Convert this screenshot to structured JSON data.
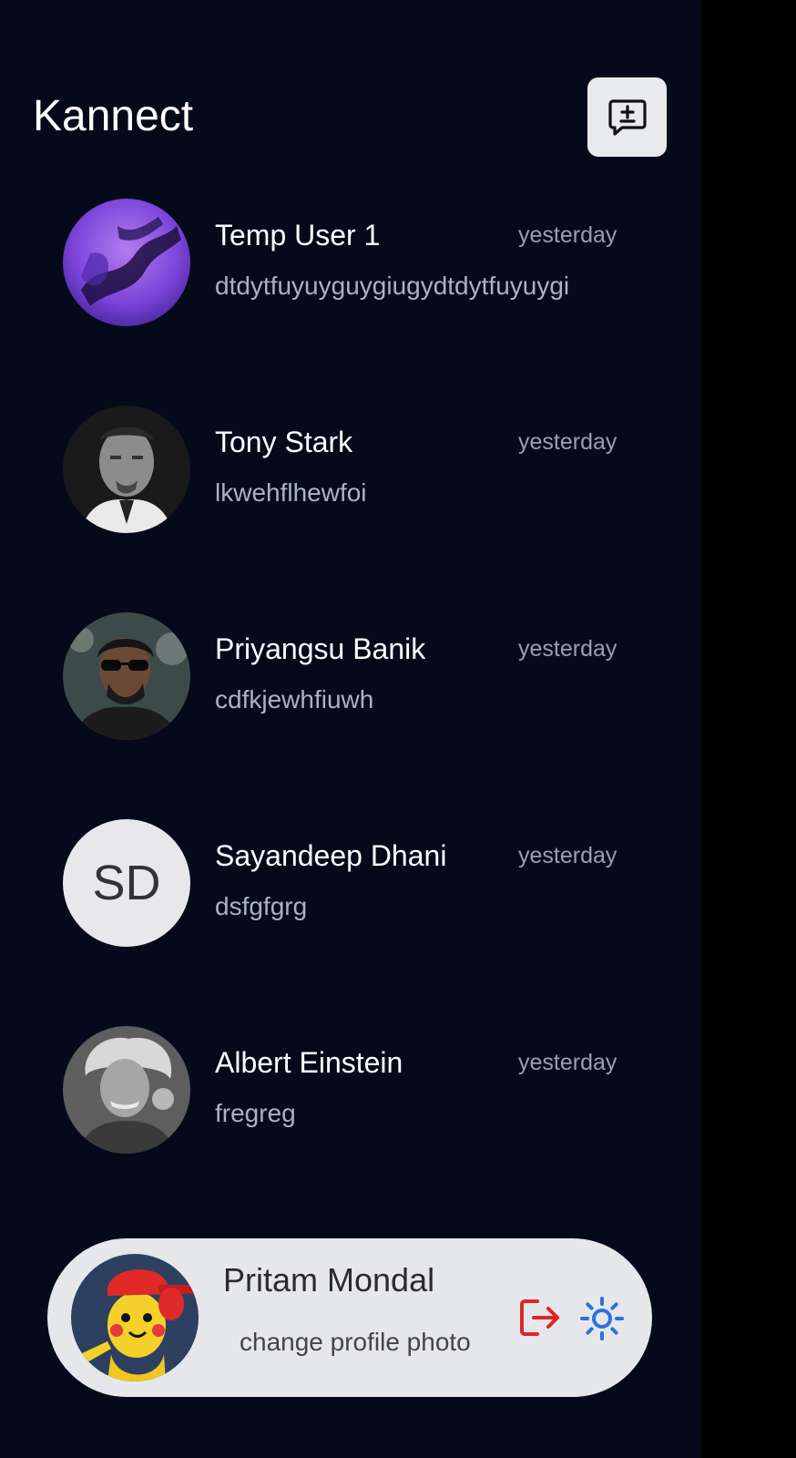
{
  "app": {
    "title": "Kannect"
  },
  "header": {
    "new_chat_icon": "new-chat-icon"
  },
  "chats": [
    {
      "name": "Temp User 1",
      "time": "yesterday",
      "preview": "dtdytfuyuyguygiugydtdytfuyuygi",
      "avatar": "abstract-purple-avatar"
    },
    {
      "name": "Tony Stark",
      "time": "yesterday",
      "preview": "lkwehflhewfoi",
      "avatar": "tony-stark-photo"
    },
    {
      "name": "Priyangsu Banik",
      "time": "yesterday",
      "preview": "cdfkjewhfiuwh",
      "avatar": "priyangsu-photo"
    },
    {
      "name": "Sayandeep Dhani",
      "time": "yesterday",
      "preview": "dsfgfgrg",
      "avatar_initials": "SD"
    },
    {
      "name": "Albert Einstein",
      "time": "yesterday",
      "preview": "fregreg",
      "avatar": "einstein-photo"
    }
  ],
  "profile": {
    "name": "Pritam Mondal",
    "change_photo_label": "change profile photo",
    "logout_icon": "logout-icon",
    "theme_icon": "sun-icon"
  },
  "colors": {
    "background": "#040a1a",
    "logout": "#e0242c",
    "theme": "#2f6fde"
  }
}
